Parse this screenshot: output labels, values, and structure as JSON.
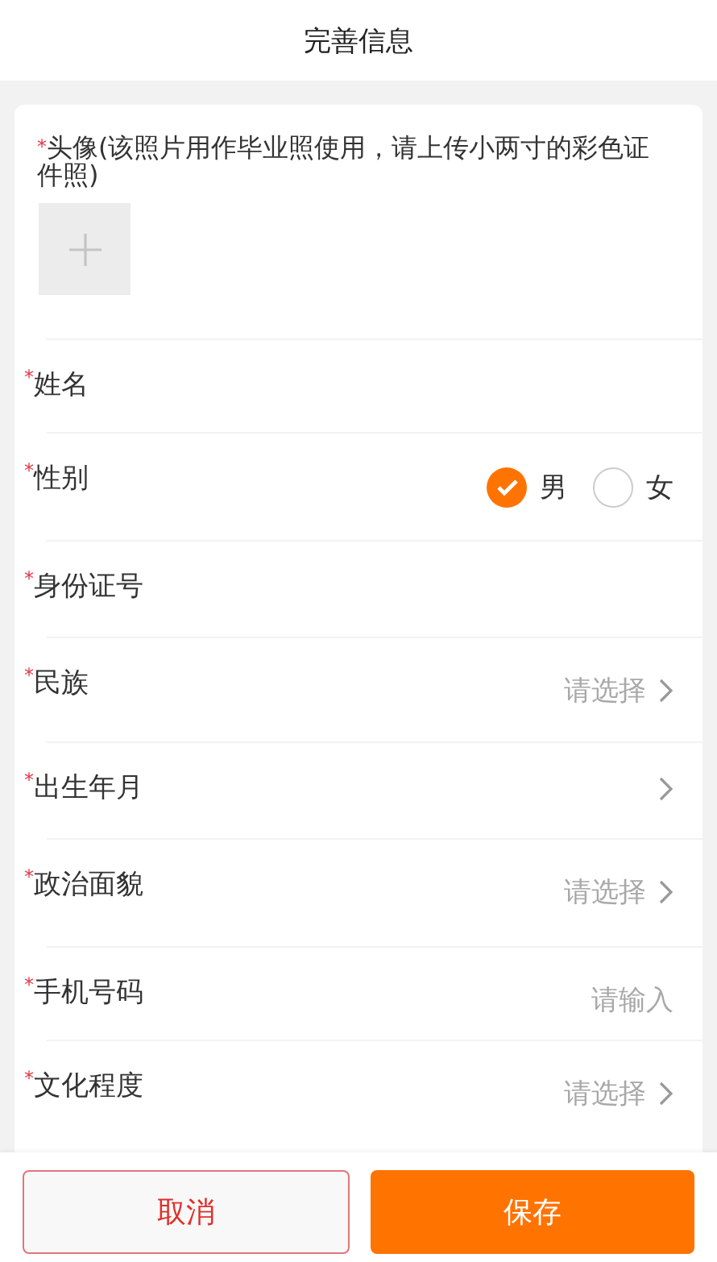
{
  "header": {
    "title": "完善信息"
  },
  "avatar": {
    "required_mark": "*",
    "label": "头像(该照片用作毕业照使用，请上传小两寸的彩色证件照)"
  },
  "fields": [
    {
      "kind": "text",
      "required_mark": "*",
      "label": "姓名"
    },
    {
      "kind": "gender",
      "required_mark": "*",
      "label": "性别",
      "options": [
        {
          "label": "男",
          "selected": true
        },
        {
          "label": "女",
          "selected": false
        }
      ]
    },
    {
      "kind": "text",
      "required_mark": "*",
      "label": "身份证号"
    },
    {
      "kind": "select",
      "required_mark": "*",
      "label": "民族",
      "placeholder": "请选择"
    },
    {
      "kind": "select",
      "required_mark": "*",
      "label": "出生年月"
    },
    {
      "kind": "select",
      "required_mark": "*",
      "label": "政治面貌",
      "placeholder": "请选择"
    },
    {
      "kind": "input",
      "required_mark": "*",
      "label": "手机号码",
      "placeholder": "请输入"
    },
    {
      "kind": "select",
      "required_mark": "*",
      "label": "文化程度",
      "placeholder": "请选择"
    }
  ],
  "buttons": [
    {
      "kind": "cancel",
      "label": "取消"
    },
    {
      "kind": "save",
      "label": "保存"
    }
  ]
}
